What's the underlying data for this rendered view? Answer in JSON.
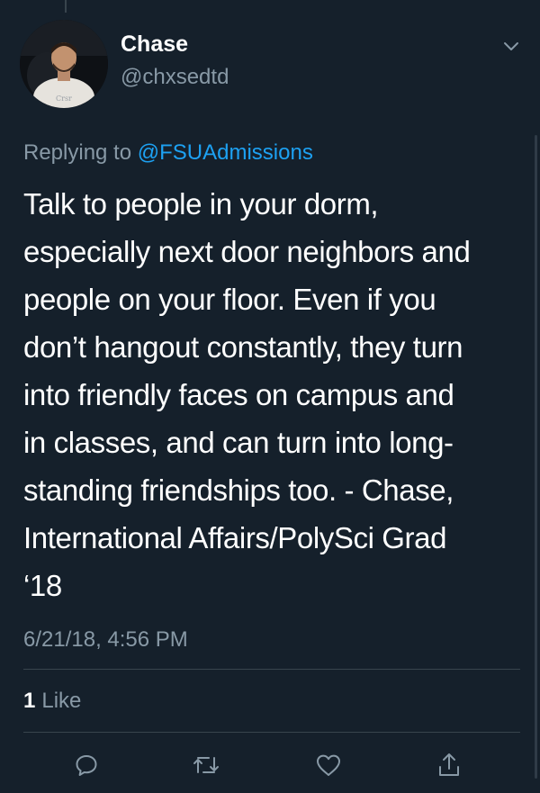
{
  "user": {
    "display_name": "Chase",
    "handle": "@chxsedtd"
  },
  "reply": {
    "prefix": "Replying to ",
    "mention": "@FSUAdmissions"
  },
  "tweet": {
    "lines": [
      "Talk to people in your dorm,",
      "especially next door neighbors and",
      "people on your floor. Even if you",
      "don’t hangout constantly, they turn",
      "into friendly faces on campus and",
      "in classes, and can turn into long-",
      "standing friendships too. - Chase,",
      "International Affairs/PolySci Grad",
      "‘18"
    ]
  },
  "timestamp": "6/21/18, 4:56 PM",
  "stats": {
    "like_count": "1",
    "like_label": "Like"
  },
  "icons": {
    "caret": "chevron-down-icon",
    "reply": "comment-icon",
    "retweet": "retweet-icon",
    "like": "heart-icon",
    "share": "share-icon"
  },
  "colors": {
    "background": "#15202b",
    "secondary_text": "#8899a6",
    "link": "#1da1f2",
    "divider": "#38444d"
  }
}
